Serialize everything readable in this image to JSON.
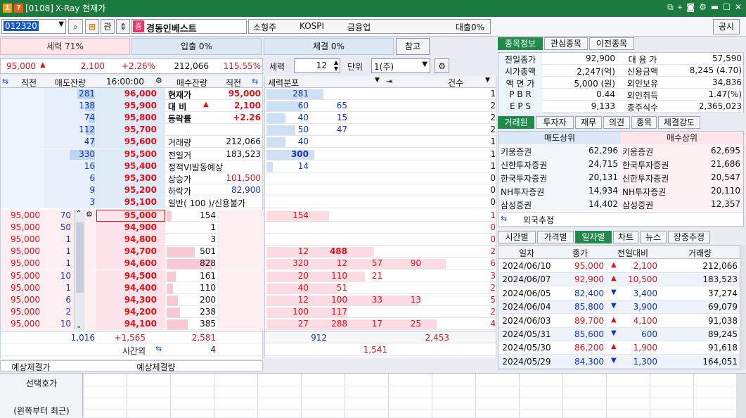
{
  "title": {
    "code": "[0108]",
    "name": "X-Ray 현재가",
    "badge1": "1",
    "badge2": "?"
  },
  "search": {
    "code": "012320",
    "stock": "경동인베스트",
    "kwan": "관"
  },
  "info": {
    "size": "소형주",
    "market": "KOSPI",
    "sector": "금융업",
    "loan": "대출0%",
    "notice": "공시"
  },
  "ratio": {
    "force": "세력 71%",
    "in": "입출 0%",
    "exec": "체결 0%",
    "ref": "참고"
  },
  "price": {
    "cur": "95,000",
    "arrow": "▲",
    "diff": "2,100",
    "pct": "+2.26%",
    "vol": "212,066",
    "rate": "115.55%"
  },
  "ctl": {
    "seryeok_lbl": "세력",
    "seryeok_val": "12",
    "unit_lbl": "단위",
    "unit_val": "1(주)",
    "dist_lbl": "세력분포",
    "cnt_lbl": "건수"
  },
  "ob_head": {
    "a": "직전",
    "b": "매도잔량",
    "c": "16:00:00",
    "d": "매수잔량",
    "e": "직전"
  },
  "asks": [
    [
      "281",
      "96,000"
    ],
    [
      "138",
      "95,900"
    ],
    [
      "74",
      "95,800"
    ],
    [
      "112",
      "95,700"
    ],
    [
      "47",
      "95,600"
    ],
    [
      "330",
      "95,500"
    ],
    [
      "16",
      "95,400"
    ],
    [
      "6",
      "95,300"
    ],
    [
      "9",
      "95,200"
    ],
    [
      "3",
      "95,100"
    ]
  ],
  "askfill": [
    0.35,
    0.2,
    0.12,
    0.18,
    0.07,
    0.5,
    0.03,
    0.01,
    0.02,
    0.01
  ],
  "bids": [
    [
      "95,000",
      "70",
      "95,000",
      "154"
    ],
    [
      "95,000",
      "50",
      "94,900",
      "1"
    ],
    [
      "95,000",
      "1",
      "94,800",
      "3"
    ],
    [
      "95,000",
      "1",
      "94,700",
      "501"
    ],
    [
      "95,000",
      "1",
      "94,600",
      "828"
    ],
    [
      "95,000",
      "10",
      "94,500",
      "161"
    ],
    [
      "95,000",
      "1",
      "94,400",
      "110"
    ],
    [
      "95,000",
      "6",
      "94,300",
      "200"
    ],
    [
      "95,000",
      "2",
      "94,200",
      "238"
    ],
    [
      "95,000",
      "10",
      "94,100",
      "385"
    ]
  ],
  "bidfill": [
    0.1,
    0,
    0,
    0.55,
    0.9,
    0.18,
    0.13,
    0.22,
    0.27,
    0.42
  ],
  "mid": [
    [
      "현재가",
      "",
      "95,000"
    ],
    [
      "대 비",
      "▲",
      "2,100"
    ],
    [
      "등락률",
      "",
      "+2.26"
    ],
    [
      "",
      "",
      ""
    ],
    [
      "거래량",
      "",
      "212,066"
    ],
    [
      "전일거",
      "",
      "183,523"
    ],
    [
      "정적VI발동예상",
      "",
      ""
    ],
    [
      "상승가",
      "",
      "101,500"
    ],
    [
      "하락가",
      "",
      "82,900"
    ],
    [
      "일반( 100 )/신용불가",
      "",
      ""
    ]
  ],
  "ob_tot": {
    "ask": "1,016",
    "diff": "+1,565",
    "bid": "2,581",
    "ovt_lbl": "시간외",
    "ovt": "4"
  },
  "exp": {
    "a": "예상체결가",
    "b": "예상체결량"
  },
  "dist_ask": [
    [
      "281",
      "",
      "",
      "",
      ""
    ],
    [
      "60",
      "65",
      "",
      "",
      ""
    ],
    [
      "40",
      "15",
      "",
      "",
      ""
    ],
    [
      "50",
      "47",
      "",
      "",
      ""
    ],
    [
      "40",
      "",
      "",
      "",
      ""
    ],
    [
      "300",
      "",
      "",
      "",
      ""
    ],
    [
      "14",
      "",
      "",
      "",
      ""
    ],
    [
      "",
      "",
      "",
      "",
      ""
    ],
    [
      "",
      "",
      "",
      "",
      ""
    ],
    [
      "",
      "",
      "",
      "",
      ""
    ]
  ],
  "dist_askfill": [
    0.9,
    0.55,
    0.3,
    0.45,
    0.3,
    0.75,
    0.1,
    0,
    0,
    0
  ],
  "dist_bid": [
    [
      "154",
      "",
      "",
      "",
      ""
    ],
    [
      "",
      "",
      "",
      "",
      ""
    ],
    [
      "",
      "",
      "",
      "",
      ""
    ],
    [
      "12",
      "488",
      "",
      "",
      ""
    ],
    [
      "320",
      "12",
      "57",
      "90",
      ""
    ],
    [
      "20",
      "110",
      "21",
      "",
      ""
    ],
    [
      "40",
      "51",
      "",
      "",
      ""
    ],
    [
      "12",
      "100",
      "33",
      "13",
      ""
    ],
    [
      "100",
      "117",
      "",
      "",
      ""
    ],
    [
      "27",
      "288",
      "17",
      "25",
      ""
    ]
  ],
  "dist_bidfill": [
    0.35,
    0,
    0,
    0.6,
    1,
    0.55,
    0.4,
    0.85,
    0.45,
    0.95
  ],
  "cnt_ask": [
    "1",
    "2",
    "2",
    "2",
    "1",
    "1",
    "1",
    "0",
    "0",
    "0"
  ],
  "cnt_bid": [
    "1",
    "0",
    "0",
    "2",
    "6",
    "3",
    "2",
    "5",
    "2",
    "4"
  ],
  "dist_tot": {
    "a": "912",
    "b": "2,453",
    "c": "1,541"
  },
  "tabs1": [
    "종목정보",
    "관심종목",
    "이전종목"
  ],
  "info_tbl": [
    [
      "전일종가",
      "92,900",
      "대 용 가",
      "57,590"
    ],
    [
      "시가총액",
      "2,247(억)",
      "신용금액",
      "8,245  (4.70)"
    ],
    [
      "액 면 가",
      "5,000 (원)",
      "외인보유",
      "34,836"
    ],
    [
      "P B R",
      "0.44",
      "외인취득",
      "1.47(%)"
    ],
    [
      "E P S",
      "9,133",
      "총주식수",
      "2,365,023"
    ]
  ],
  "tabs2": [
    "거래원",
    "투자자",
    "재무",
    "의견",
    "종목",
    "체결강도"
  ],
  "broker_head": [
    "매도상위",
    "매수상위"
  ],
  "brokers": [
    [
      "키움증권",
      "62,296",
      "키움증권",
      "62,695"
    ],
    [
      "신한투자증권",
      "24,715",
      "한국투자증권",
      "21,686"
    ],
    [
      "한국투자증권",
      "20,131",
      "신한투자증권",
      "20,547"
    ],
    [
      "NH투자증권",
      "14,934",
      "NH투자증권",
      "20,110"
    ],
    [
      "삼성증권",
      "14,402",
      "삼성증권",
      "12,357"
    ]
  ],
  "foreign": "외국추정",
  "tabs3": [
    "시간별",
    "가격별",
    "일자별",
    "차트",
    "뉴스",
    "장중추정"
  ],
  "daily_head": [
    "일자",
    "종가",
    "전일대비",
    "거래량"
  ],
  "daily": [
    [
      "2024/06/10",
      "95,000",
      "▲",
      "2,100",
      "212,066"
    ],
    [
      "2024/06/07",
      "92,900",
      "▲",
      "10,500",
      "183,523"
    ],
    [
      "2024/06/05",
      "82,400",
      "▼",
      "3,400",
      "37,274"
    ],
    [
      "2024/06/04",
      "85,800",
      "▼",
      "3,900",
      "69,079"
    ],
    [
      "2024/06/03",
      "89,700",
      "▲",
      "4,100",
      "91,038"
    ],
    [
      "2024/05/31",
      "85,600",
      "▼",
      "600",
      "89,245"
    ],
    [
      "2024/05/30",
      "86,200",
      "▲",
      "1,900",
      "91,618"
    ],
    [
      "2024/05/29",
      "84,300",
      "▼",
      "1,300",
      "164,051"
    ]
  ],
  "bottom": {
    "a": "선택호가",
    "b": "(왼쪽부터 최근)"
  }
}
